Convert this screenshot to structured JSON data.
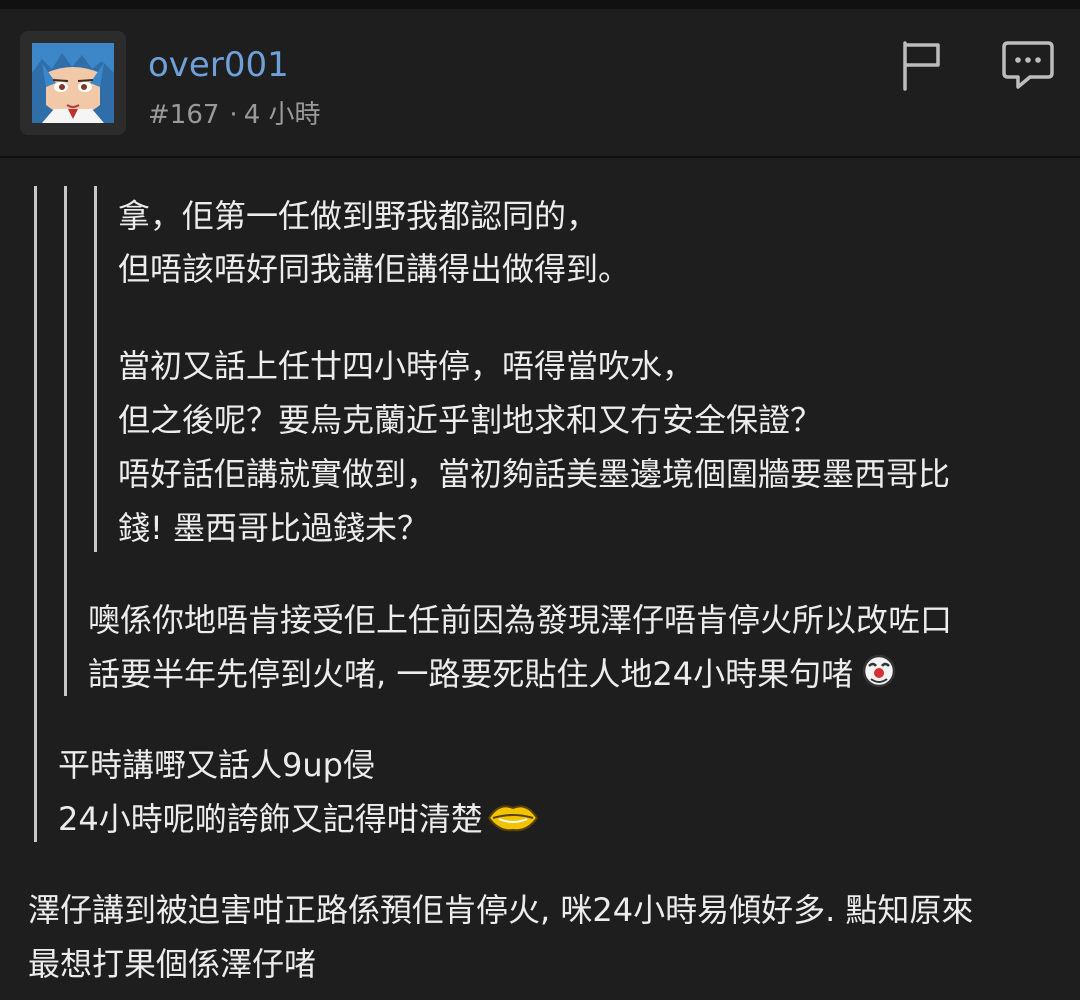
{
  "post": {
    "username": "over001",
    "post_number": "#167",
    "time_separator": "·",
    "time_ago": "4 小時",
    "avatar_icon": "anime-avatar",
    "actions": {
      "report_icon": "flag-icon",
      "reply_icon": "comment-icon"
    }
  },
  "quote_level_3": [
    "拿，佢第一任做到野我都認同的，",
    "但唔該唔好同我講佢講得出做得到。",
    "當初又話上任廿四小時停，唔得當吹水，",
    "但之後呢？要烏克蘭近乎割地求和又冇安全保證？",
    "唔好話佢講就實做到，當初夠話美墨邊境個圍牆要墨西哥比",
    "錢! 墨西哥比過錢未？"
  ],
  "quote_level_2": [
    "噢係你地唔肯接受佢上任前因為發現澤仔唔肯停火所以改咗口",
    "話要半年先停到火啫, 一路要死貼住人地24小時果句啫"
  ],
  "quote_level_1": [
    "平時講嘢又話人9up侵",
    "24小時呢啲誇飾又記得咁清楚"
  ],
  "reply": [
    "澤仔講到被迫害咁正路係預佢肯停火, 咪24小時易傾好多. 點知原來",
    "最想打果個係澤仔啫"
  ],
  "emoji": {
    "clown": "clown-emoji",
    "lips": "lips-emoji"
  },
  "colors": {
    "background": "#1e1e1e",
    "username": "#6fa0d8",
    "meta": "#9a9a9a",
    "text": "#ececec",
    "quote_bar": "#c8c8c8"
  }
}
